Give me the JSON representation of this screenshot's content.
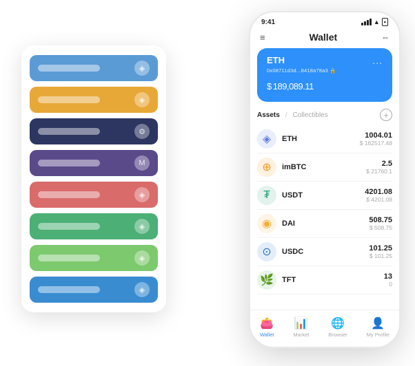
{
  "app": {
    "title": "Wallet"
  },
  "status_bar": {
    "time": "9:41",
    "signal": "signal",
    "wifi": "wifi",
    "battery": "battery"
  },
  "hero_card": {
    "token": "ETH",
    "address": "0x08711d3d...8418a78a3",
    "emoji": "🔒",
    "currency_symbol": "$",
    "amount": "189,089.11",
    "more": "..."
  },
  "assets_section": {
    "tab_active": "Assets",
    "tab_divider": "/",
    "tab_inactive": "Collectibles"
  },
  "assets": [
    {
      "name": "ETH",
      "icon": "◈",
      "icon_color": "#627EEA",
      "amount": "1004.01",
      "usd": "$ 162517.48"
    },
    {
      "name": "imBTC",
      "icon": "⊕",
      "icon_color": "#F7931A",
      "amount": "2.5",
      "usd": "$ 21760.1"
    },
    {
      "name": "USDT",
      "icon": "₮",
      "icon_color": "#26A17B",
      "amount": "4201.08",
      "usd": "$ 4201.08"
    },
    {
      "name": "DAI",
      "icon": "◉",
      "icon_color": "#F5AC37",
      "amount": "508.75",
      "usd": "$ 508.75"
    },
    {
      "name": "USDC",
      "icon": "⊙",
      "icon_color": "#2775CA",
      "amount": "101.25",
      "usd": "$ 101.25"
    },
    {
      "name": "TFT",
      "icon": "🌿",
      "icon_color": "#4CAF50",
      "amount": "13",
      "usd": "0"
    }
  ],
  "bottom_nav": [
    {
      "label": "Wallet",
      "icon": "👛",
      "active": true
    },
    {
      "label": "Market",
      "icon": "📊",
      "active": false
    },
    {
      "label": "Browser",
      "icon": "🌐",
      "active": false
    },
    {
      "label": "My Profile",
      "icon": "👤",
      "active": false
    }
  ],
  "left_panel": {
    "cards": [
      {
        "color": "#5B9BD5",
        "icon": "◈"
      },
      {
        "color": "#E8A838",
        "icon": "◈"
      },
      {
        "color": "#2D3561",
        "icon": "⚙"
      },
      {
        "color": "#5B4A8A",
        "icon": "M"
      },
      {
        "color": "#D96B6B",
        "icon": "◈"
      },
      {
        "color": "#4CAF76",
        "icon": "◈"
      },
      {
        "color": "#7DC96E",
        "icon": "◈"
      },
      {
        "color": "#3A8CD1",
        "icon": "◈"
      }
    ]
  }
}
